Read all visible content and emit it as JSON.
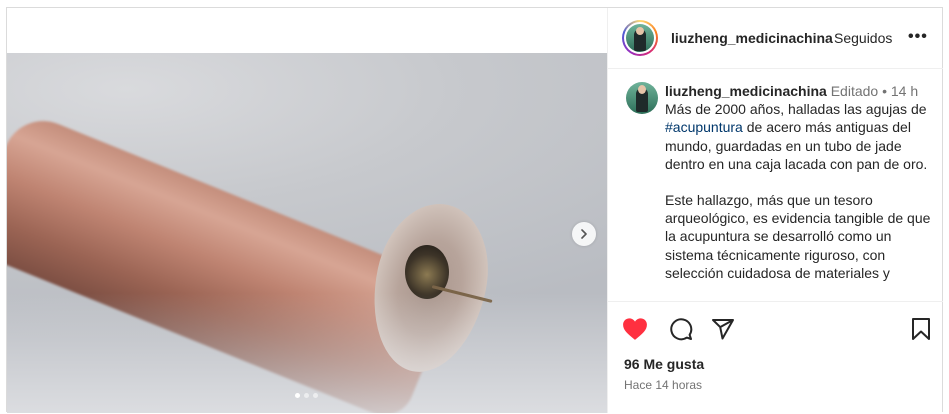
{
  "post": {
    "username": "liuzheng_medicinachina",
    "follow_status": "Seguidos",
    "more_label": "•••",
    "caption": {
      "edited_label": "Editado",
      "separator": "•",
      "time_short": "14 h",
      "paragraph1_before": "Más de 2000 años, halladas las agujas de ",
      "hashtag": "#acupuntura",
      "paragraph1_after": " de acero más antiguas del mundo, guardadas en  un tubo de jade dentro en una caja lacada con pan de oro.",
      "paragraph2": "Este hallazgo, más que un tesoro arqueológico, es evidencia tangible de que la acupuntura se desarrolló como un sistema técnicamente riguroso, con selección cuidadosa de materiales y"
    },
    "likes_label": "96 Me gusta",
    "time_ago": "Hace 14 horas"
  },
  "media": {
    "carousel_dots": 3,
    "active_dot": 1
  },
  "icons": {
    "like": "heart-filled-icon",
    "comment": "comment-icon",
    "share": "send-icon",
    "save": "bookmark-icon",
    "next": "chevron-right-icon",
    "more": "more-horizontal-icon"
  },
  "colors": {
    "like_red": "#ff3040",
    "hashtag_blue": "#00376b",
    "secondary_text": "#737373"
  }
}
